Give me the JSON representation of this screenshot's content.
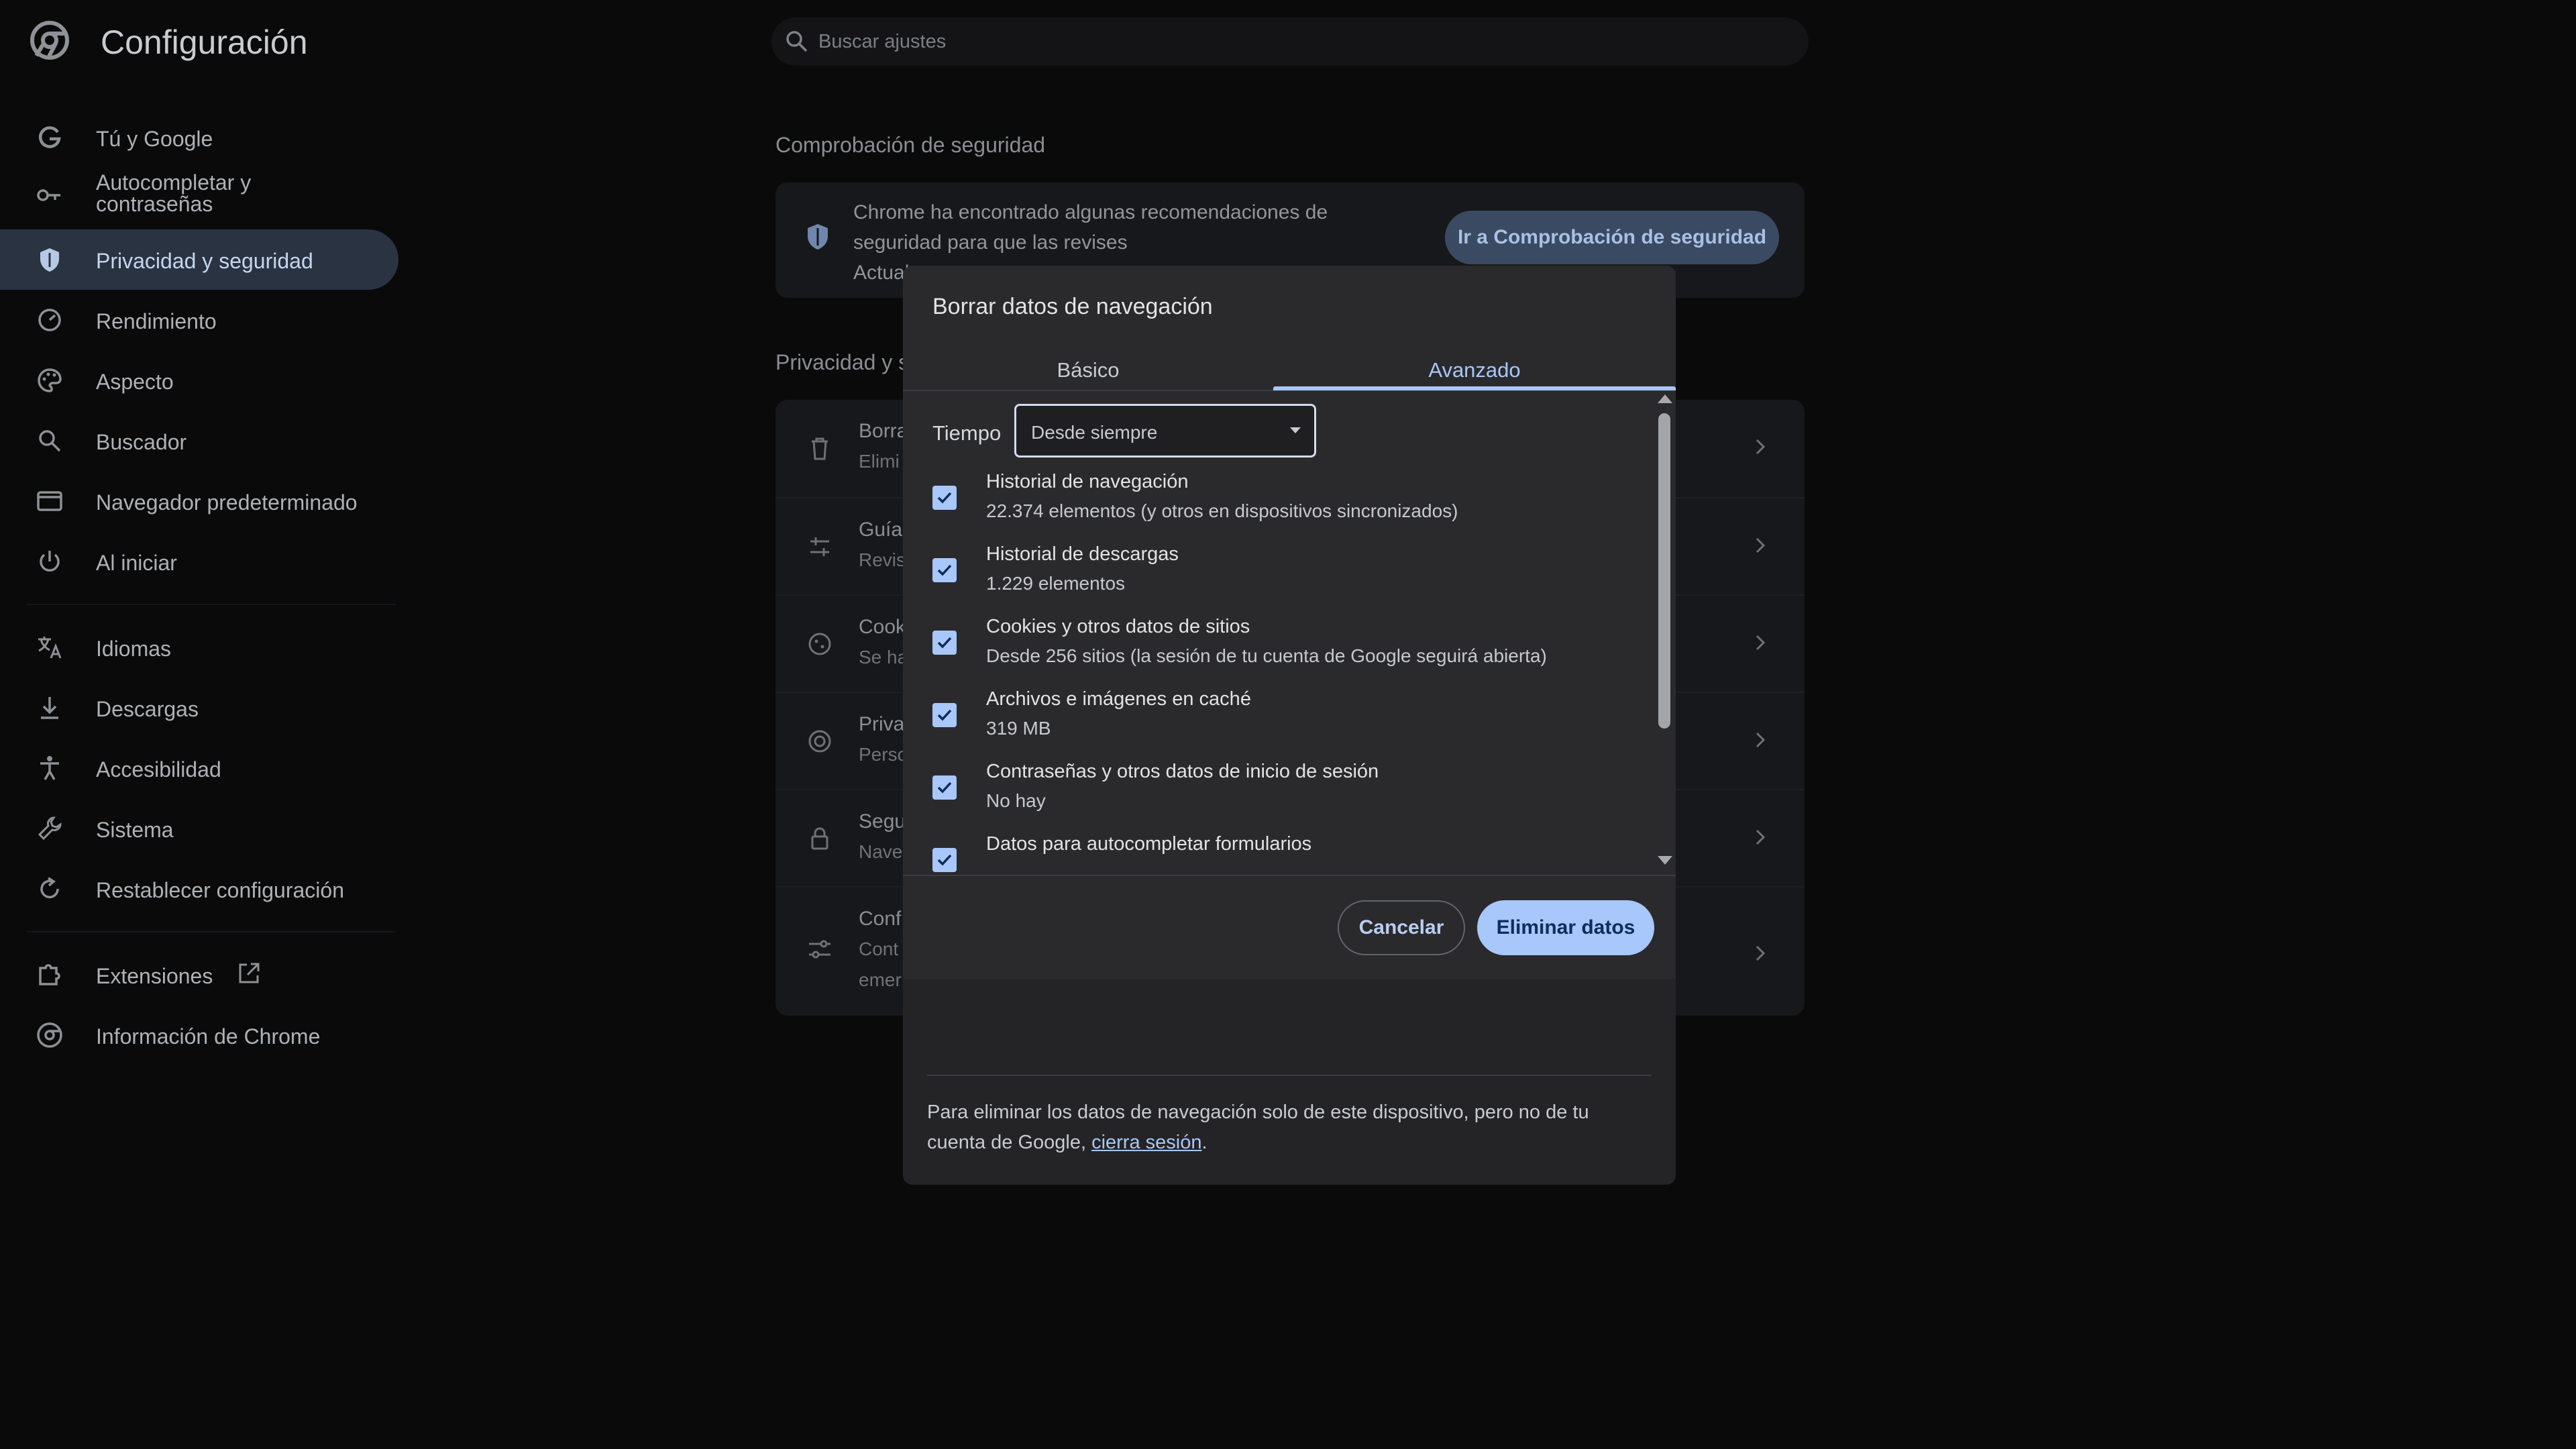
{
  "app": {
    "title": "Configuración"
  },
  "search": {
    "placeholder": "Buscar ajustes"
  },
  "sidebar": {
    "items": [
      {
        "label": "Tú y Google",
        "icon": "google-icon"
      },
      {
        "label": "Autocompletar y contraseñas",
        "icon": "key-icon"
      },
      {
        "label": "Privacidad y seguridad",
        "icon": "shield-icon",
        "active": true
      },
      {
        "label": "Rendimiento",
        "icon": "speedometer-icon"
      },
      {
        "label": "Aspecto",
        "icon": "palette-icon"
      },
      {
        "label": "Buscador",
        "icon": "search-icon"
      },
      {
        "label": "Navegador predeterminado",
        "icon": "browser-window-icon"
      },
      {
        "label": "Al iniciar",
        "icon": "power-icon"
      },
      {
        "label": "Idiomas",
        "icon": "translate-icon"
      },
      {
        "label": "Descargas",
        "icon": "download-icon"
      },
      {
        "label": "Accesibilidad",
        "icon": "accessibility-icon"
      },
      {
        "label": "Sistema",
        "icon": "wrench-icon"
      },
      {
        "label": "Restablecer configuración",
        "icon": "reset-icon"
      },
      {
        "label": "Extensiones",
        "icon": "puzzle-icon"
      },
      {
        "label": "Información de Chrome",
        "icon": "chrome-icon"
      }
    ]
  },
  "main": {
    "safety_heading": "Comprobación de seguridad",
    "safety_text": "Chrome ha encontrado algunas recomendaciones de seguridad para que las revises",
    "safety_partial": "Actual",
    "safety_button": "Ir a Comprobación de seguridad",
    "privacy_heading": "Privacidad y s",
    "rows": [
      {
        "title": "Borra",
        "sub": "Elimi",
        "icon": "trash-icon"
      },
      {
        "title": "Guía",
        "sub": "Revis",
        "icon": "tune-icon"
      },
      {
        "title": "Cook",
        "sub": "Se ha",
        "icon": "cookie-icon"
      },
      {
        "title": "Priva",
        "sub": "Perso",
        "icon": "ad-privacy-icon"
      },
      {
        "title": "Segu",
        "sub": "Nave",
        "icon": "lock-icon"
      },
      {
        "title": "Conf",
        "sub": "Cont",
        "sub2": "emer",
        "icon": "sliders-icon"
      }
    ]
  },
  "dialog": {
    "title": "Borrar datos de navegación",
    "tabs": {
      "basic": "Básico",
      "advanced": "Avanzado"
    },
    "time_label": "Tiempo",
    "time_value": "Desde siempre",
    "items": [
      {
        "title": "Historial de navegación",
        "sub": "22.374 elementos (y otros en dispositivos sincronizados)",
        "checked": true
      },
      {
        "title": "Historial de descargas",
        "sub": "1.229 elementos",
        "checked": true
      },
      {
        "title": "Cookies y otros datos de sitios",
        "sub": "Desde 256 sitios (la sesión de tu cuenta de Google seguirá abierta)",
        "checked": true
      },
      {
        "title": "Archivos e imágenes en caché",
        "sub": "319 MB",
        "checked": true
      },
      {
        "title": "Contraseñas y otros datos de inicio de sesión",
        "sub": "No hay",
        "checked": true
      },
      {
        "title": "Datos para autocompletar formularios",
        "sub": "",
        "checked": true
      }
    ],
    "cancel": "Cancelar",
    "delete": "Eliminar datos",
    "footer_text": "Para eliminar los datos de navegación solo de este dispositivo, pero no de tu cuenta de Google, ",
    "footer_link": "cierra sesión",
    "footer_end": "."
  },
  "colors": {
    "accent": "#a8c7fa",
    "active_nav_bg": "#2a3342"
  }
}
